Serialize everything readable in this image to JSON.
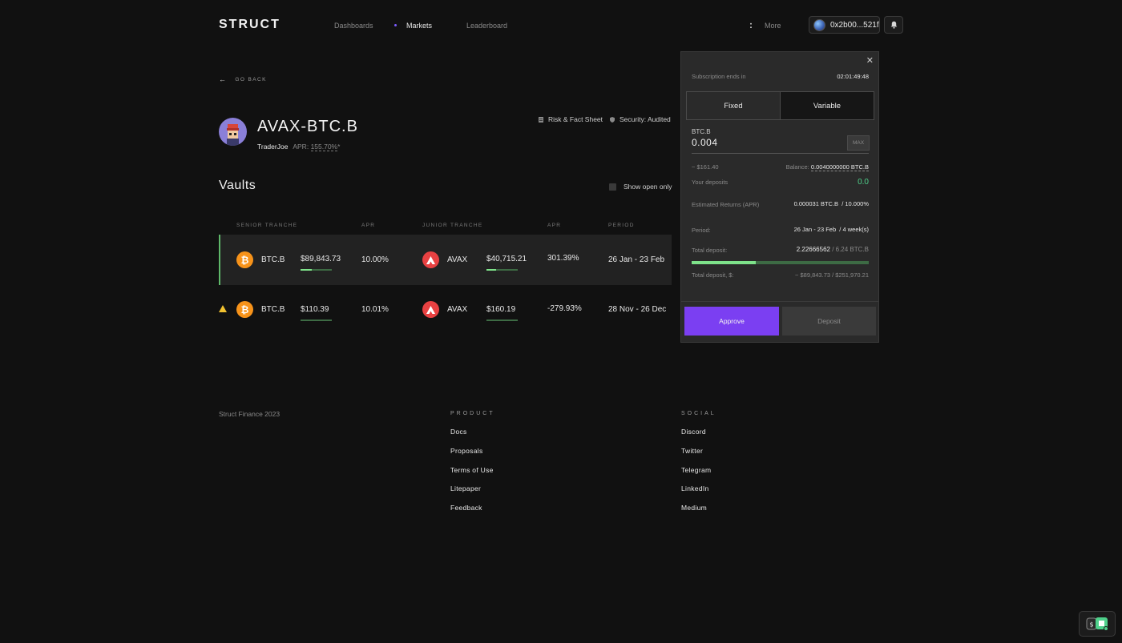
{
  "header": {
    "logo": "STRUCT",
    "nav": [
      "Dashboards",
      "Markets",
      "Leaderboard"
    ],
    "more_label": "More",
    "wallet": "0x2b00...521f"
  },
  "goback": {
    "label": "GO BACK"
  },
  "pair": {
    "title": "AVAX-BTC.B",
    "protocol": "TraderJoe",
    "apr_label": "APR:",
    "apr_value": "155.70%",
    "apr_suffix": "*",
    "links": [
      "Risk & Fact Sheet",
      "Security: Audited"
    ]
  },
  "vaults": {
    "title": "Vaults",
    "show_open_label": "Show open only",
    "columns": [
      "SENIOR TRANCHE",
      "APR",
      "JUNIOR TRANCHE",
      "APR",
      "PERIOD"
    ],
    "rows": [
      {
        "senior_token": "BTC.B",
        "senior_value": "$89,843.73",
        "senior_progress": 0.36,
        "senior_apr": "10.00%",
        "junior_token": "AVAX",
        "junior_value": "$40,715.21",
        "junior_progress": 0.3,
        "junior_apr": "301.39%",
        "period": "26 Jan - 23 Feb",
        "warning": false
      },
      {
        "senior_token": "BTC.B",
        "senior_value": "$110.39",
        "senior_progress": 1.0,
        "senior_apr": "10.01%",
        "junior_token": "AVAX",
        "junior_value": "$160.19",
        "junior_progress": 1.0,
        "junior_apr": "-279.93%",
        "period": "28 Nov - 26 Dec",
        "warning": true
      }
    ]
  },
  "panel": {
    "subscription_label": "Subscription ends in",
    "subscription_timer": "02:01:49:48",
    "tabs": [
      "Fixed",
      "Variable"
    ],
    "token": "BTC.B",
    "amount": "0.004",
    "max_label": "MAX",
    "usd_estimate": "~ $161.40",
    "balance_label": "Balance:",
    "balance_value": "0.0040000000 BTC.B",
    "your_deposits_label": "Your deposits",
    "your_deposits_value": "0.0",
    "est_returns_label": "Estimated Returns (APR)",
    "est_returns_value": "0.000031 BTC.B  / 10.000%",
    "period_label": "Period:",
    "period_value": "26 Jan - 23 Feb  / 4 week(s)",
    "total_deposit_label": "Total deposit:",
    "total_deposit_value": "2.22666562",
    "total_deposit_cap": " / 6.24 BTC.B",
    "total_deposit_progress": 0.36,
    "total_deposit_usd_label": "Total deposit, $:",
    "total_deposit_usd_value": "~ $89,843.73 / $251,970.21",
    "approve_label": "Approve",
    "deposit_label": "Deposit"
  },
  "footer": {
    "copyright": "Struct Finance 2023",
    "product_heading": "PRODUCT",
    "product_links": [
      "Docs",
      "Proposals",
      "Terms of Use",
      "Litepaper",
      "Feedback"
    ],
    "social_heading": "SOCIAL",
    "social_links": [
      "Discord",
      "Twitter",
      "Telegram",
      "LinkedIn",
      "Medium"
    ]
  },
  "colors": {
    "accent": "#7b3ff2",
    "positive": "#4fd18b",
    "progress": "#7ee28a",
    "btc": "#f7931a",
    "avax": "#e84142",
    "warning": "#f2c230"
  }
}
